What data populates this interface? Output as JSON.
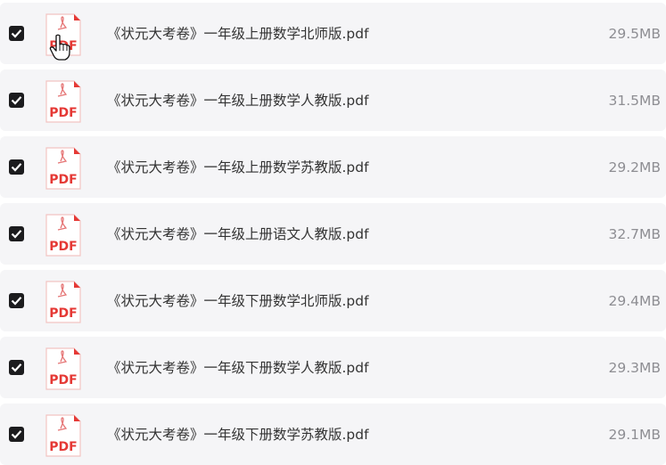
{
  "colors": {
    "row_background": "#f5f5f7",
    "checkbox_fill": "#1c1c1e",
    "pdf_accent": "#e53935",
    "filename_text": "#333333",
    "size_text": "#8e8e93"
  },
  "icons": {
    "checkbox": "checkbox-checked-icon",
    "file": "pdf-file-icon",
    "pointer": "hand-pointer-cursor-icon"
  },
  "files": [
    {
      "checked": true,
      "icon_label": "PDF",
      "name": "《状元大考卷》一年级上册数学北师版.pdf",
      "size": "29.5MB"
    },
    {
      "checked": true,
      "icon_label": "PDF",
      "name": "《状元大考卷》一年级上册数学人教版.pdf",
      "size": "31.5MB"
    },
    {
      "checked": true,
      "icon_label": "PDF",
      "name": "《状元大考卷》一年级上册数学苏教版.pdf",
      "size": "29.2MB"
    },
    {
      "checked": true,
      "icon_label": "PDF",
      "name": "《状元大考卷》一年级上册语文人教版.pdf",
      "size": "32.7MB"
    },
    {
      "checked": true,
      "icon_label": "PDF",
      "name": "《状元大考卷》一年级下册数学北师版.pdf",
      "size": "29.4MB"
    },
    {
      "checked": true,
      "icon_label": "PDF",
      "name": "《状元大考卷》一年级下册数学人教版.pdf",
      "size": "29.3MB"
    },
    {
      "checked": true,
      "icon_label": "PDF",
      "name": "《状元大考卷》一年级下册数学苏教版.pdf",
      "size": "29.1MB"
    }
  ]
}
